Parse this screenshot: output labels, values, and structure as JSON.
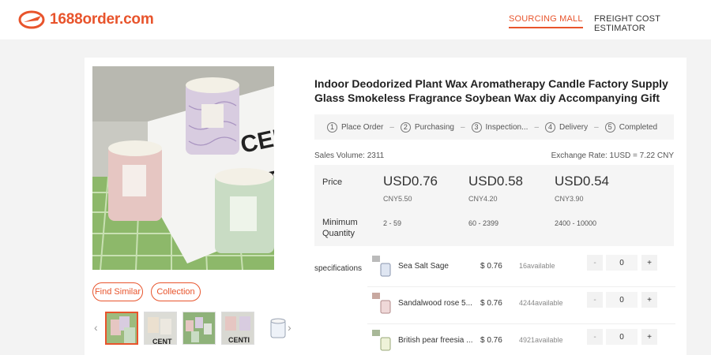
{
  "header": {
    "logo_text": "1688order.com",
    "nav": [
      {
        "label": "SOURCING MALL",
        "active": true
      },
      {
        "label": "FREIGHT COST ESTIMATOR",
        "active": false
      }
    ]
  },
  "gallery": {
    "buttons": {
      "find_similar": "Find Similar",
      "collection": "Collection"
    },
    "thumbnail_count": 5,
    "active_thumbnail": 0
  },
  "product": {
    "title": "Indoor Deodorized Plant Wax Aromatherapy Candle Factory Supply Glass Smokeless Fragrance Soybean Wax diy Accompanying Gift",
    "steps": [
      {
        "num": "1",
        "label": "Place Order"
      },
      {
        "num": "2",
        "label": "Purchasing"
      },
      {
        "num": "3",
        "label": "Inspection..."
      },
      {
        "num": "4",
        "label": "Delivery"
      },
      {
        "num": "5",
        "label": "Completed"
      }
    ],
    "sales_volume": "Sales Volume:  2311",
    "exchange_rate": "Exchange Rate: 1USD = 7.22 CNY",
    "price_label": "Price",
    "min_qty_label_1": "Minimum",
    "min_qty_label_2": "Quantity",
    "tiers": [
      {
        "usd": "USD0.76",
        "cny": "CNY5.50",
        "qty": "2 - 59"
      },
      {
        "usd": "USD0.58",
        "cny": "CNY4.20",
        "qty": "60 - 2399"
      },
      {
        "usd": "USD0.54",
        "cny": "CNY3.90",
        "qty": "2400 - 10000"
      }
    ],
    "specifications_label": "specifications",
    "specs": [
      {
        "name": "Sea Salt Sage",
        "price": "$ 0.76",
        "available": "16available",
        "qty": "0"
      },
      {
        "name": "Sandalwood rose 5...",
        "price": "$ 0.76",
        "available": "4244available",
        "qty": "0"
      },
      {
        "name": "British pear freesia ...",
        "price": "$ 0.76",
        "available": "4921available",
        "qty": "0"
      }
    ],
    "minus_symbol": "-",
    "plus_symbol": "+"
  },
  "colors": {
    "accent": "#e8542c"
  }
}
